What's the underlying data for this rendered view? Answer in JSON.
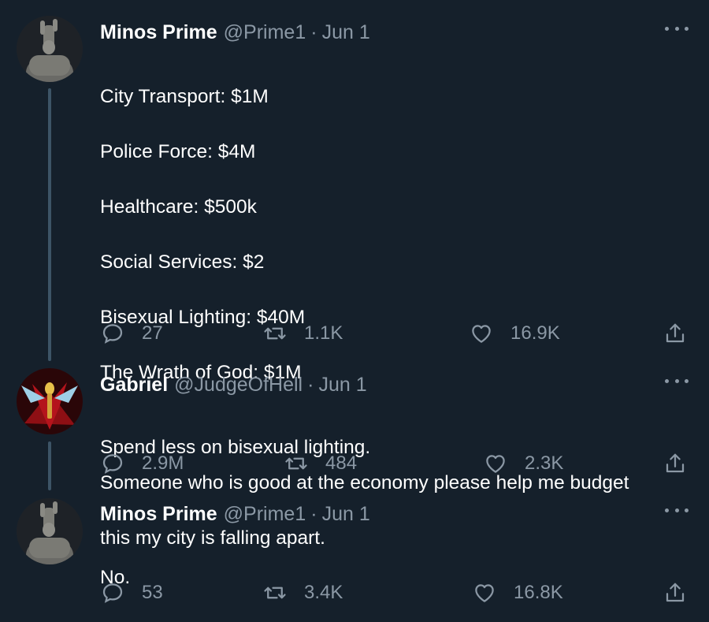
{
  "tweets": [
    {
      "name": "Minos Prime",
      "handle": "@Prime1",
      "separator": "·",
      "date": "Jun 1",
      "avatar_icon": "minos-avatar",
      "lines": [
        "City Transport: $1M",
        "Police Force: $4M",
        "Healthcare: $500k",
        "Social Services: $2",
        "Bisexual Lighting: $40M",
        "The Wrath of God: $1M",
        "",
        "Someone who is good at the economy please help me budget",
        "this my city is falling apart."
      ],
      "replies": "27",
      "retweets": "1.1K",
      "likes": "16.9K"
    },
    {
      "name": "Gabriel",
      "handle": "@JudgeOfHell",
      "separator": "·",
      "date": "Jun 1",
      "avatar_icon": "gabriel-avatar",
      "lines": [
        "Spend less on bisexual lighting."
      ],
      "replies": "2.9M",
      "retweets": "484",
      "likes": "2.3K"
    },
    {
      "name": "Minos Prime",
      "handle": "@Prime1",
      "separator": "·",
      "date": "Jun 1",
      "avatar_icon": "minos-avatar",
      "lines": [
        "No."
      ],
      "replies": "53",
      "retweets": "3.4K",
      "likes": "16.8K"
    }
  ],
  "colors": {
    "background": "#15202b",
    "text": "#ffffff",
    "muted": "#8b98a5",
    "thread_line": "#3d5466"
  }
}
